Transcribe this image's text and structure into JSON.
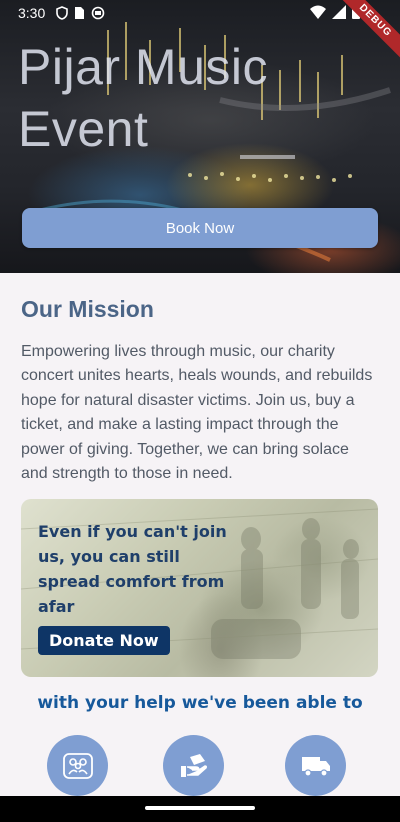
{
  "status_bar": {
    "time": "3:30",
    "debug_label": "DEBUG",
    "icons": [
      "shield-icon",
      "sim-card-icon",
      "sync-icon",
      "wifi-icon",
      "cellular-signal-icon",
      "battery-icon"
    ]
  },
  "hero": {
    "title": "Pijar Music Event",
    "book_button_label": "Book Now"
  },
  "mission": {
    "title": "Our Mission",
    "text": "Empowering lives through music, our charity concert unites hearts, heals wounds, and rebuilds hope for natural disaster victims. Join us, buy a ticket, and make a lasting impact through the power of giving. Together, we can bring solace and strength to those in need."
  },
  "donate_card": {
    "text": "Even if you can't join us, you can still spread comfort from afar",
    "button_label": "Donate Now"
  },
  "impact": {
    "heading": "with your help we've been able to",
    "icons": [
      "people-group-icon",
      "donation-hand-icon",
      "delivery-truck-icon"
    ]
  },
  "colors": {
    "accent": "#7f9ed2",
    "mission_title": "#4b6587",
    "heading_blue": "#17599b",
    "donate_button": "#0e3566",
    "background": "#f6f3f6"
  }
}
